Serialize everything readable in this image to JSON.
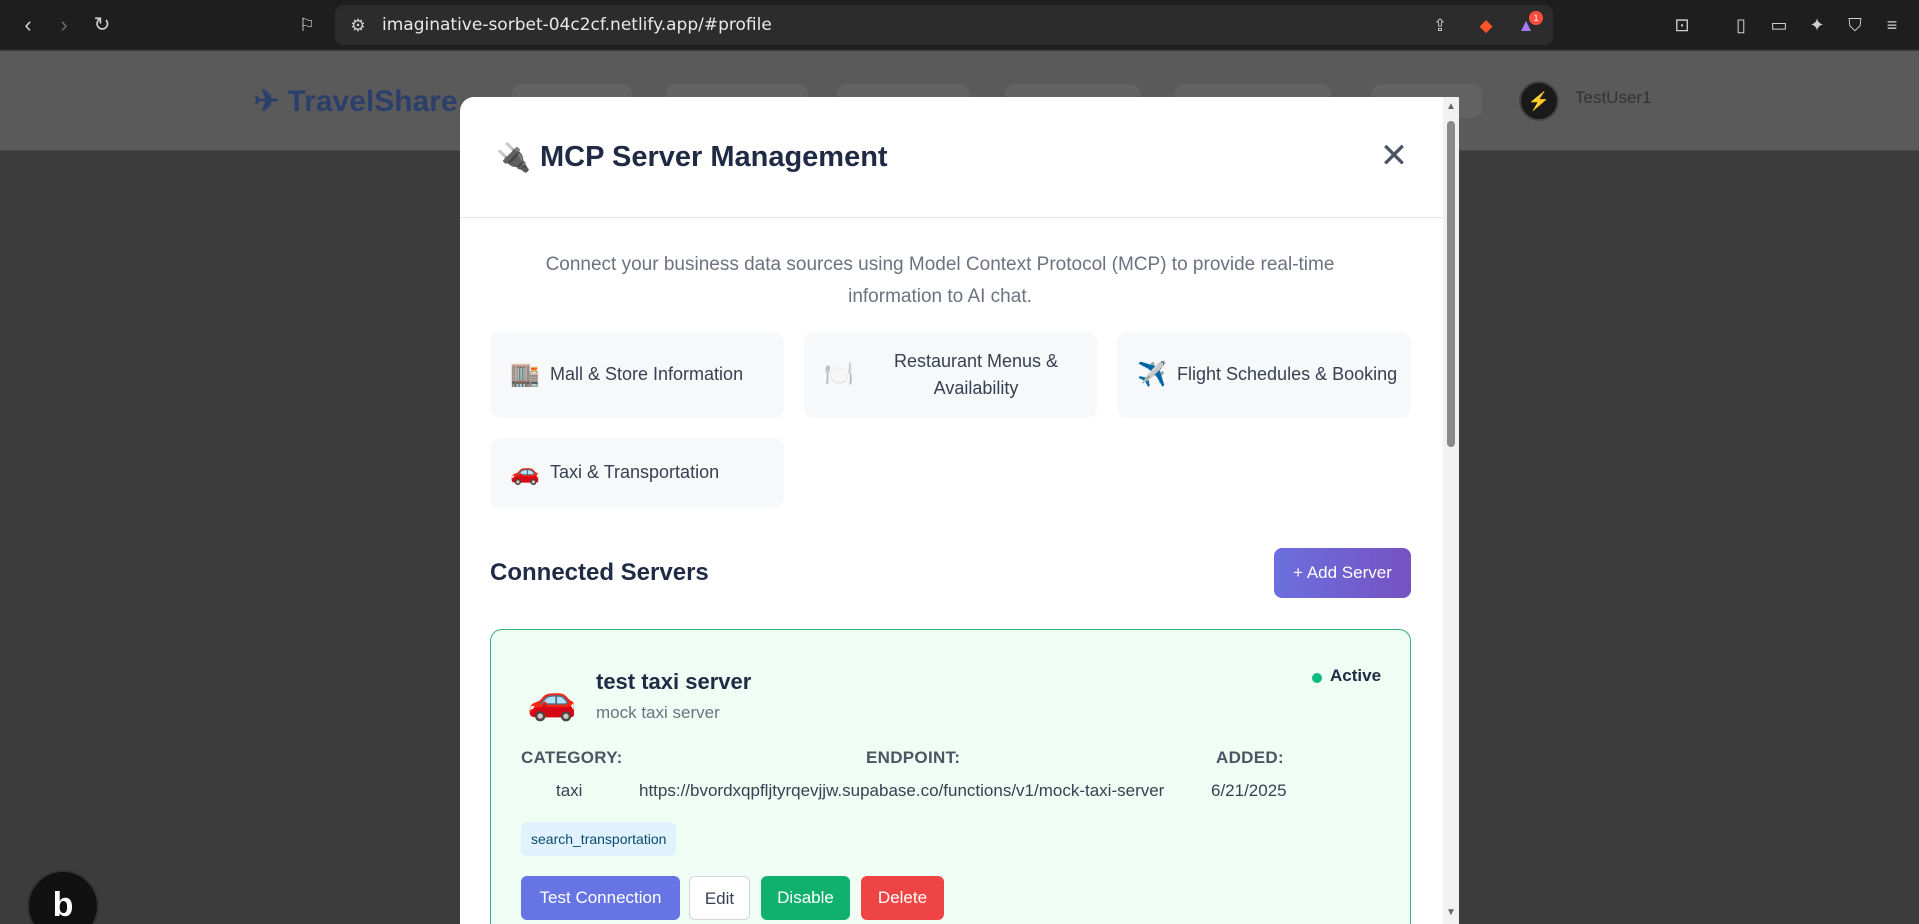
{
  "browser": {
    "url": "imaginative-sorbet-04c2cf.netlify.app/#profile",
    "notification_count": "1"
  },
  "app": {
    "logo_text": "TravelShare",
    "username": "TestUser1"
  },
  "modal": {
    "title": "MCP Server Management",
    "intro": "Connect your business data sources using Model Context Protocol (MCP) to provide real-time information to AI chat.",
    "categories": [
      {
        "icon": "🏬",
        "label": "Mall & Store Information"
      },
      {
        "icon": "🍽️",
        "label": "Restaurant Menus & Availability"
      },
      {
        "icon": "✈️",
        "label": "Flight Schedules & Booking"
      },
      {
        "icon": "🚗",
        "label": "Taxi & Transportation"
      }
    ],
    "connected_title": "Connected Servers",
    "add_button": "+ Add Server",
    "server": {
      "icon": "🚗",
      "name": "test taxi server",
      "description": "mock taxi server",
      "status": "Active",
      "status_color": "#10b981",
      "labels": {
        "category": "CATEGORY:",
        "endpoint": "ENDPOINT:",
        "added": "ADDED:"
      },
      "category": "taxi",
      "endpoint": "https://bvordxqpfljtyrqevjjw.supabase.co/functions/v1/mock-taxi-server",
      "added": "6/21/2025",
      "tool": "search_transportation",
      "buttons": {
        "test": "Test Connection",
        "edit": "Edit",
        "disable": "Disable",
        "delete": "Delete"
      }
    }
  }
}
